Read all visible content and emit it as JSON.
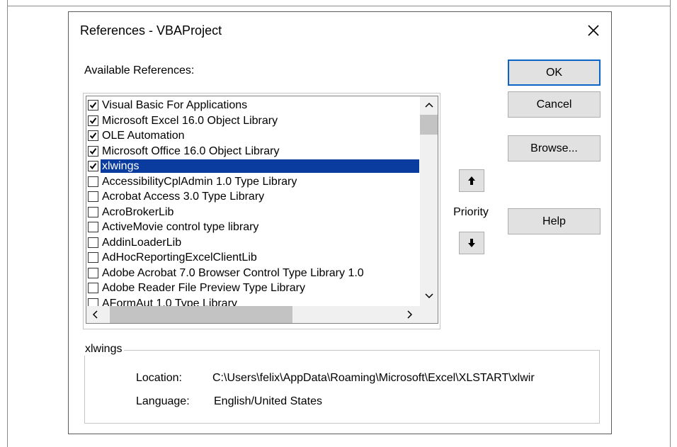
{
  "dialog": {
    "title": "References - VBAProject",
    "available_label": "Available References:"
  },
  "references": [
    {
      "label": "Visual Basic For Applications",
      "checked": true,
      "selected": false
    },
    {
      "label": "Microsoft Excel 16.0 Object Library",
      "checked": true,
      "selected": false
    },
    {
      "label": "OLE Automation",
      "checked": true,
      "selected": false
    },
    {
      "label": "Microsoft Office 16.0 Object Library",
      "checked": true,
      "selected": false
    },
    {
      "label": "xlwings",
      "checked": true,
      "selected": true
    },
    {
      "label": "AccessibilityCplAdmin 1.0 Type Library",
      "checked": false,
      "selected": false
    },
    {
      "label": "Acrobat Access 3.0 Type Library",
      "checked": false,
      "selected": false
    },
    {
      "label": "AcroBrokerLib",
      "checked": false,
      "selected": false
    },
    {
      "label": "ActiveMovie control type library",
      "checked": false,
      "selected": false
    },
    {
      "label": "AddinLoaderLib",
      "checked": false,
      "selected": false
    },
    {
      "label": "AdHocReportingExcelClientLib",
      "checked": false,
      "selected": false
    },
    {
      "label": "Adobe Acrobat 7.0 Browser Control Type Library 1.0",
      "checked": false,
      "selected": false
    },
    {
      "label": "Adobe Reader File Preview Type Library",
      "checked": false,
      "selected": false
    },
    {
      "label": "AFormAut 1.0 Type Library",
      "checked": false,
      "selected": false
    }
  ],
  "buttons": {
    "ok": "OK",
    "cancel": "Cancel",
    "browse": "Browse...",
    "help": "Help"
  },
  "priority": {
    "label": "Priority"
  },
  "details": {
    "group_title": "xlwings",
    "location_label": "Location:",
    "location_value": "C:\\Users\\felix\\AppData\\Roaming\\Microsoft\\Excel\\XLSTART\\xlwir",
    "language_label": "Language:",
    "language_value": "English/United States"
  },
  "icons": {
    "close": "close-icon",
    "check": "checkmark-icon",
    "up": "arrow-up-icon",
    "down": "arrow-down-icon"
  },
  "colors": {
    "selection": "#0a3ca0",
    "default_button_border": "#0a64c8",
    "button_face": "#e1e1e1"
  }
}
